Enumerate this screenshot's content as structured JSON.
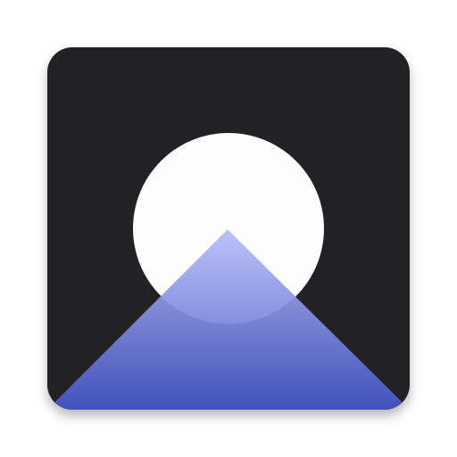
{
  "app_icon": {
    "icon_name": "mountain-moon-icon",
    "colors": {
      "tile_background": "#202125",
      "moon": "#fdfdfd",
      "mountain_top": "#c8ceff",
      "mountain_bottom": "#4555c6",
      "mountain_overlay": "#4c5ccc"
    }
  }
}
